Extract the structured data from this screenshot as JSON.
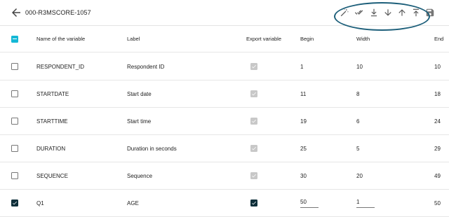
{
  "toolbar": {
    "title": "000-R3MSCORE-1057",
    "icons": [
      "back-arrow-icon",
      "magic-wand-icon",
      "double-check-icon",
      "move-to-bottom-icon",
      "move-down-icon",
      "move-up-icon",
      "move-to-top-icon",
      "save-icon"
    ]
  },
  "table": {
    "headers": {
      "name": "Name of the variable",
      "label": "Label",
      "export": "Export variable",
      "begin": "Begin",
      "width": "Width",
      "end": "End"
    },
    "select_all_state": "indeterminate",
    "rows": [
      {
        "selected": false,
        "name": "RESPONDENT_ID",
        "label": "Respondent ID",
        "export": true,
        "begin": "1",
        "width": "10",
        "end": "10",
        "editable": false
      },
      {
        "selected": false,
        "name": "STARTDATE",
        "label": "Start date",
        "export": true,
        "begin": "11",
        "width": "8",
        "end": "18",
        "editable": false
      },
      {
        "selected": false,
        "name": "STARTTIME",
        "label": "Start time",
        "export": true,
        "begin": "19",
        "width": "6",
        "end": "24",
        "editable": false
      },
      {
        "selected": false,
        "name": "DURATION",
        "label": "Duration in seconds",
        "export": true,
        "begin": "25",
        "width": "5",
        "end": "29",
        "editable": false
      },
      {
        "selected": false,
        "name": "SEQUENCE",
        "label": "Sequence",
        "export": true,
        "begin": "30",
        "width": "20",
        "end": "49",
        "editable": false
      },
      {
        "selected": true,
        "name": "Q1",
        "label": "AGE",
        "export": true,
        "begin": "50",
        "width": "1",
        "end": "50",
        "editable": true
      }
    ]
  },
  "colors": {
    "accent": "#15b8d6",
    "checked": "#0e2f3a",
    "disabled_check": "#c8c8c8",
    "annotation_ring": "#1d5f7a"
  }
}
